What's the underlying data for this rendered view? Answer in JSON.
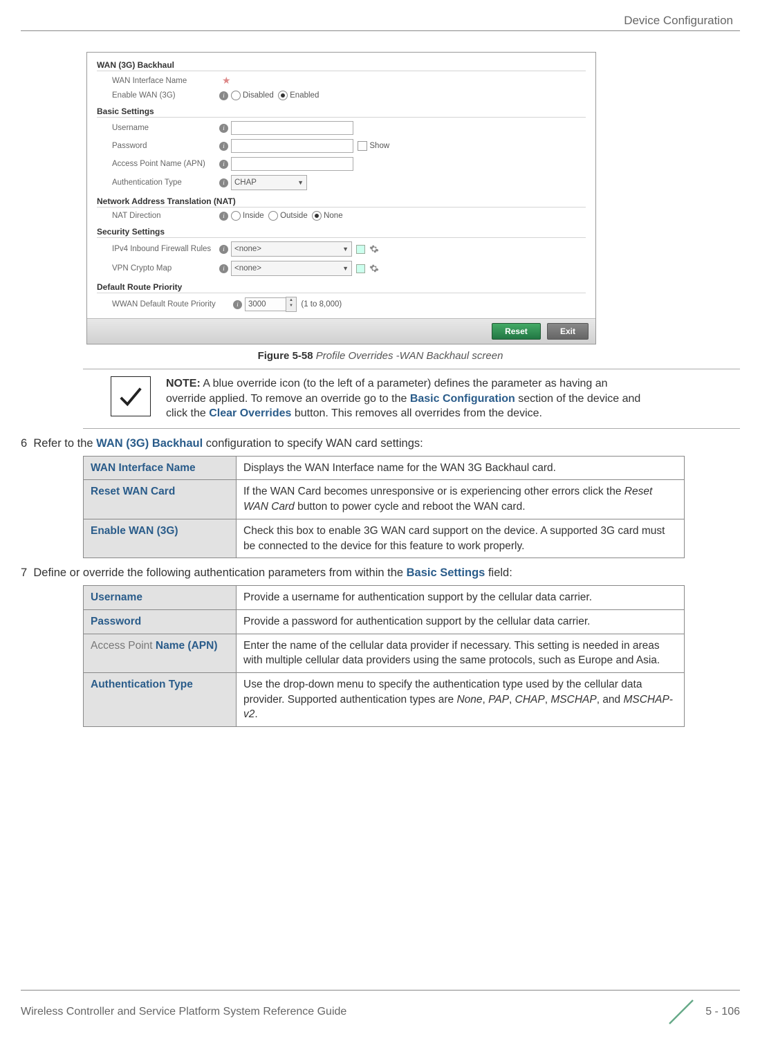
{
  "header": {
    "section": "Device Configuration"
  },
  "screenshot": {
    "wan_backhaul": {
      "legend": "WAN (3G) Backhaul",
      "wan_interface_name_label": "WAN Interface Name",
      "enable_wan_label": "Enable WAN (3G)",
      "disabled": "Disabled",
      "enabled": "Enabled"
    },
    "basic_settings": {
      "legend": "Basic Settings",
      "username_label": "Username",
      "password_label": "Password",
      "show_label": "Show",
      "apn_label": "Access Point Name (APN)",
      "auth_type_label": "Authentication Type",
      "auth_value": "CHAP"
    },
    "nat": {
      "legend": "Network Address Translation (NAT)",
      "nat_direction_label": "NAT Direction",
      "inside": "Inside",
      "outside": "Outside",
      "none": "None"
    },
    "security": {
      "legend": "Security Settings",
      "ipv4_label": "IPv4 Inbound Firewall Rules",
      "vpn_label": "VPN Crypto Map",
      "none_value": "<none>"
    },
    "route": {
      "legend": "Default Route Priority",
      "priority_label": "WWAN Default Route Priority",
      "priority_value": "3000",
      "range": "(1 to 8,000)"
    },
    "buttons": {
      "reset": "Reset",
      "exit": "Exit"
    }
  },
  "caption": {
    "fig": "Figure 5-58",
    "text": "Profile Overrides -WAN Backhaul screen"
  },
  "note": {
    "bold": "NOTE:",
    "t1": " A blue override icon (to the left of a parameter) defines the parameter as having an override applied. To remove an override go to the ",
    "link1": "Basic Configuration",
    "t2": " section of the device and click the ",
    "link2": "Clear Overrides",
    "t3": " button. This removes all overrides from the device."
  },
  "step6": {
    "num": "6",
    "t1": "Refer to the ",
    "link": "WAN (3G) Backhaul",
    "t2": " configuration to specify WAN card settings:"
  },
  "table1": {
    "r1h": "WAN Interface Name",
    "r1d": "Displays the WAN Interface name for the WAN 3G Backhaul card.",
    "r2h": "Reset WAN Card",
    "r2d_a": "If the WAN Card becomes unresponsive or is experiencing other errors click the ",
    "r2d_i": "Reset WAN Card",
    "r2d_b": " button to power cycle and reboot the WAN card.",
    "r3h": "Enable WAN (3G)",
    "r3d": "Check this box to enable 3G WAN card support on the device. A supported 3G card must be connected to the device for this feature to work properly."
  },
  "step7": {
    "num": "7",
    "t1": "Define or override the following authentication parameters from within the ",
    "link": "Basic Settings",
    "t2": " field:"
  },
  "table2": {
    "r1h": "Username",
    "r1d": "Provide a username for authentication support by the cellular data carrier.",
    "r2h": "Password",
    "r2d": "Provide a password for authentication support by the cellular data carrier.",
    "r3h_pre": "Access Point ",
    "r3h": "Name (APN)",
    "r3d": "Enter the name of the cellular data provider if necessary. This setting is needed in areas with multiple cellular data providers using the same protocols, such as Europe and Asia.",
    "r4h": "Authentication Type",
    "r4d_a": "Use the drop-down menu to specify the authentication type used by the cellular data provider. Supported authentication types are ",
    "r4d_i1": "None",
    "r4d_c1": ", ",
    "r4d_i2": "PAP",
    "r4d_c2": ", ",
    "r4d_i3": "CHAP",
    "r4d_c3": ", ",
    "r4d_i4": "MSCHAP",
    "r4d_c4": ", and ",
    "r4d_i5": "MSCHAP-v2",
    "r4d_end": "."
  },
  "footer": {
    "left": "Wireless Controller and Service Platform System Reference Guide",
    "right": "5 - 106"
  }
}
